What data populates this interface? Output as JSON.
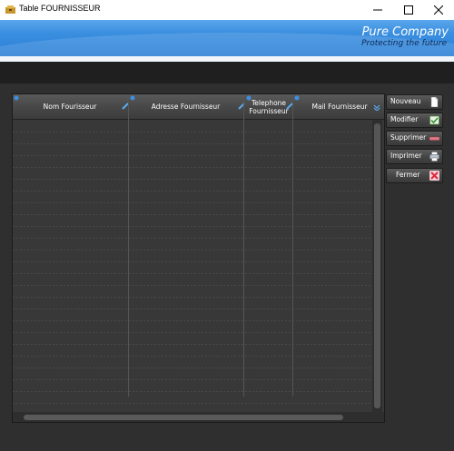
{
  "window": {
    "title": "Table FOURNISSEUR"
  },
  "banner": {
    "company": "Pure Company",
    "tagline": "Protecting the future"
  },
  "table": {
    "columns": [
      {
        "label": "Nom Fourisseur"
      },
      {
        "label": "Adresse Fournisseur"
      },
      {
        "label": "Telephone Fournisseur"
      },
      {
        "label": "Mail Fournisseur"
      }
    ],
    "rows": []
  },
  "actions": {
    "nouveau": "Nouveau",
    "modifier": "Modifier",
    "supprimer": "Supprimer",
    "imprimer": "Imprimer",
    "fermer": "Fermer"
  },
  "colors": {
    "banner": "#3b8fe0",
    "background": "#2f2f2f",
    "header": "#4a4a4a"
  },
  "icons": [
    "app-icon",
    "minimize-icon",
    "maximize-icon",
    "close-icon",
    "sort-icon",
    "edit-icon",
    "new-document-icon",
    "modify-icon",
    "delete-icon",
    "print-icon",
    "close-red-icon"
  ]
}
